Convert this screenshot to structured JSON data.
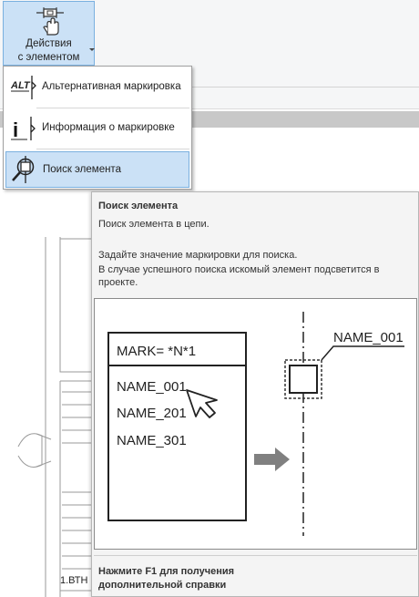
{
  "ribbon": {
    "button_line1": "Действия",
    "button_line2": "с элементом"
  },
  "menu": {
    "items": [
      {
        "label": "Альтернативная маркировка",
        "icon": "alt-marking-icon",
        "icon_text": "ALT"
      },
      {
        "label": "Информация о маркировке",
        "icon": "info-marking-icon",
        "icon_text": "i"
      },
      {
        "label": "Поиск элемента",
        "icon": "find-element-icon",
        "selected": true
      }
    ]
  },
  "tooltip": {
    "title": "Поиск элемента",
    "description": "Поиск элемента в цепи.",
    "para1": "Задайте значение маркировки для поиска.",
    "para2": "В случае успешного поиска искомый элемент подсветится в",
    "para3": "проекте.",
    "illustration": {
      "filter": "MARK= *N*1",
      "results": [
        "NAME_001",
        "NAME_201",
        "NAME_301"
      ],
      "target_label": "NAME_001"
    },
    "footer_line1": "Нажмите F1 для получения",
    "footer_line2": "дополнительной справки"
  },
  "background": {
    "partial_text": "1.ВТН"
  },
  "colors": {
    "selection_fill": "#cbe1f6",
    "selection_border": "#7ab0df",
    "tooltip_bg": "#f4f4f4",
    "arrow_gray": "#808080"
  }
}
